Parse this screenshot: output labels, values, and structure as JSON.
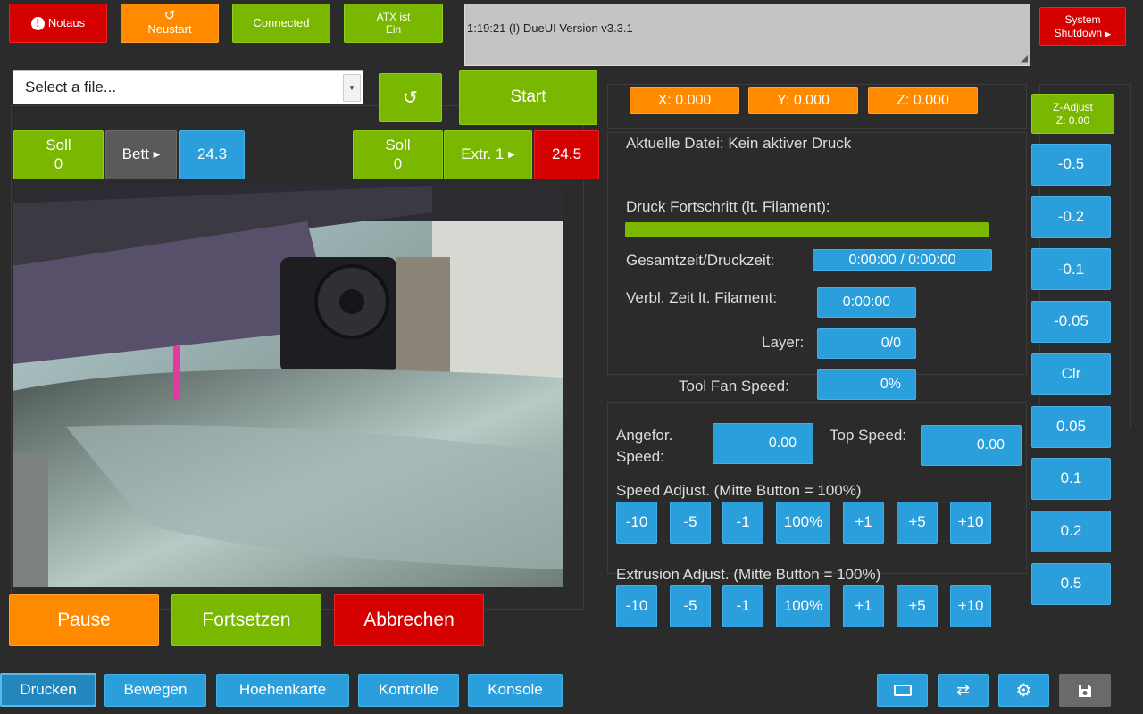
{
  "topbar": {
    "notaus": "Notaus",
    "neustart": "Neustart",
    "connected": "Connected",
    "atx_line1": "ATX ist",
    "atx_line2": "Ein",
    "log": "1:19:21 (I) DueUI Version v3.3.1",
    "shutdown_line1": "System",
    "shutdown_line2": "Shutdown"
  },
  "file": {
    "placeholder": "Select a file...",
    "start": "Start"
  },
  "temps": {
    "bed_soll_label": "Soll",
    "bed_soll_value": "0",
    "bed_label": "Bett",
    "bed_actual": "24.3",
    "extr_soll_label": "Soll",
    "extr_soll_value": "0",
    "extr_label": "Extr. 1",
    "extr_actual": "24.5"
  },
  "position": {
    "x": "X: 0.000",
    "y": "Y: 0.000",
    "z": "Z: 0.000"
  },
  "status": {
    "current_file": "Aktuelle Datei: Kein aktiver Druck",
    "progress_label": "Druck Fortschritt (lt. Filament):",
    "progress_fraction": 1.0,
    "total_time_label": "Gesamtzeit/Druckzeit:",
    "total_time_value": "0:00:00 / 0:00:00",
    "remaining_label": "Verbl. Zeit lt. Filament:",
    "remaining_value": "0:00:00",
    "layer_label": "Layer:",
    "layer_value": "0/0",
    "fan_label": "Tool Fan Speed:",
    "fan_value": "0%"
  },
  "speed": {
    "requested_label_1": "Angefor.",
    "requested_label_2": "Speed:",
    "requested_value": "0.00",
    "top_label": "Top Speed:",
    "top_value": "0.00",
    "speed_adjust_label": "Speed Adjust. (Mitte Button = 100%)",
    "extrusion_adjust_label": "Extrusion Adjust. (Mitte Button = 100%)",
    "adjust_buttons": [
      "-10",
      "-5",
      "-1",
      "100%",
      "+1",
      "+5",
      "+10"
    ]
  },
  "zadjust": {
    "title_line1": "Z-Adjust",
    "title_line2": "Z: 0.00",
    "buttons": [
      "-0.5",
      "-0.2",
      "-0.1",
      "-0.05",
      "Clr",
      "0.05",
      "0.1",
      "0.2",
      "0.5"
    ]
  },
  "job": {
    "pause": "Pause",
    "resume": "Fortsetzen",
    "cancel": "Abbrechen"
  },
  "tabs": {
    "print": "Drucken",
    "move": "Bewegen",
    "heightmap": "Hoehenkarte",
    "control": "Kontrolle",
    "console": "Konsole"
  },
  "colors": {
    "green": "#7ab700",
    "orange": "#ff8a00",
    "red": "#d50000",
    "blue": "#2b9fdc",
    "background": "#2b2b2b"
  }
}
